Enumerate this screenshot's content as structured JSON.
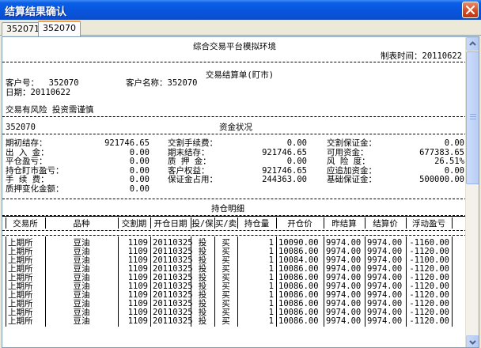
{
  "window": {
    "title": "结算结果确认",
    "close_icon": "close-icon"
  },
  "tabs": [
    {
      "label": "352071",
      "active": false
    },
    {
      "label": "352070",
      "active": true
    }
  ],
  "report": {
    "env_title": "综合交易平台模拟环境",
    "made_time": "制表时间：20110622",
    "doc_title": "交易结算单(盯市)",
    "account_label": "客户号：  352070",
    "name_label": "客户名称：352070",
    "date_label": "日期：20110622",
    "risk_note": "交易有风险 投资需谨慎",
    "account_id": "352070",
    "funds_title": "资金状况",
    "funds": {
      "col1": [
        {
          "label": "期初结存：",
          "value": "921746.65"
        },
        {
          "label": "出 入 金：",
          "value": "0.00"
        },
        {
          "label": "平仓盈亏：",
          "value": "0.00"
        },
        {
          "label": "持仓盯市盈亏：",
          "value": "0.00"
        },
        {
          "label": "手 续 费：",
          "value": "0.00"
        },
        {
          "label": "质押变化金额：",
          "value": "0.00"
        }
      ],
      "col2": [
        {
          "label": "交割手续费：",
          "value": "0.00"
        },
        {
          "label": "期末结存：",
          "value": "921746.65"
        },
        {
          "label": "质 押 金：",
          "value": "0.00"
        },
        {
          "label": "客户权益：",
          "value": "921746.65"
        },
        {
          "label": "保证金占用：",
          "value": "244363.00"
        }
      ],
      "col3": [
        {
          "label": "交割保证金：",
          "value": "0.00"
        },
        {
          "label": "可用资金：",
          "value": "677383.65"
        },
        {
          "label": "风 险 度：",
          "value": "26.51%"
        },
        {
          "label": "应追加资金：",
          "value": "0.00"
        },
        {
          "label": "基础保证金：",
          "value": "500000.00"
        }
      ]
    },
    "positions_title": "持仓明细",
    "positions_headers": [
      "交易所",
      "品种",
      "交割期",
      "开仓日期",
      "投/保",
      "买/卖",
      "持仓量",
      "开仓价",
      "昨结算",
      "结算价",
      "浮动盈亏"
    ],
    "positions_rows": [
      [
        "上期所",
        "豆油",
        "1109",
        "20110325",
        "投",
        "买",
        "1",
        "10090.00",
        "9974.00",
        "9974.00",
        "-1160.00"
      ],
      [
        "上期所",
        "豆油",
        "1109",
        "20110325",
        "投",
        "买",
        "1",
        "10086.00",
        "9974.00",
        "9974.00",
        "-1120.00"
      ],
      [
        "上期所",
        "豆油",
        "1109",
        "20110325",
        "投",
        "买",
        "1",
        "10084.00",
        "9974.00",
        "9974.00",
        "-1100.00"
      ],
      [
        "上期所",
        "豆油",
        "1109",
        "20110325",
        "投",
        "买",
        "1",
        "10086.00",
        "9974.00",
        "9974.00",
        "-1120.00"
      ],
      [
        "上期所",
        "豆油",
        "1109",
        "20110325",
        "投",
        "买",
        "1",
        "10086.00",
        "9974.00",
        "9974.00",
        "-1120.00"
      ],
      [
        "上期所",
        "豆油",
        "1109",
        "20110325",
        "投",
        "买",
        "1",
        "10086.00",
        "9974.00",
        "9974.00",
        "-1120.00"
      ],
      [
        "上期所",
        "豆油",
        "1109",
        "20110325",
        "投",
        "买",
        "1",
        "10086.00",
        "9974.00",
        "9974.00",
        "-1120.00"
      ],
      [
        "上期所",
        "豆油",
        "1109",
        "20110325",
        "投",
        "买",
        "1",
        "10086.00",
        "9974.00",
        "9974.00",
        "-1120.00"
      ],
      [
        "上期所",
        "豆油",
        "1109",
        "20110325",
        "投",
        "买",
        "1",
        "10086.00",
        "9974.00",
        "9974.00",
        "-1120.00"
      ],
      [
        "上期所",
        "豆油",
        "1109",
        "20110325",
        "投",
        "买",
        "1",
        "10086.00",
        "9974.00",
        "9974.00",
        "-1120.00"
      ]
    ]
  }
}
